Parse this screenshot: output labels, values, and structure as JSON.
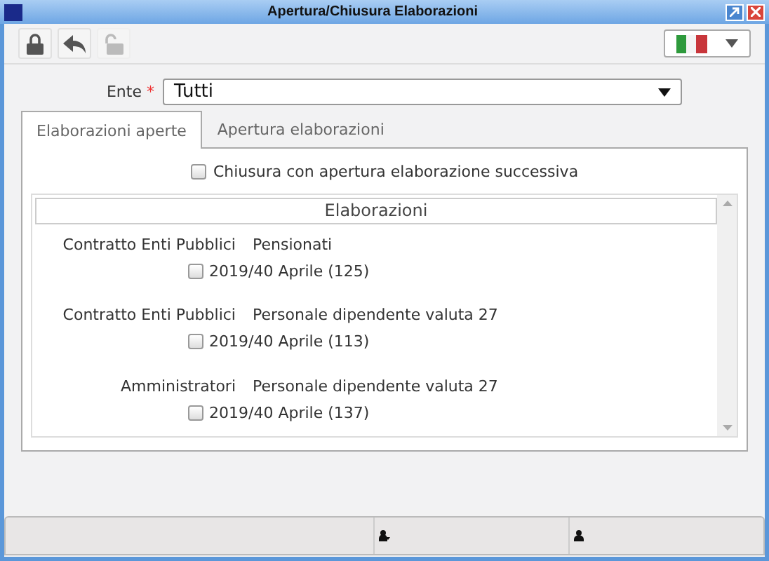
{
  "window": {
    "title": "Apertura/Chiusura Elaborazioni"
  },
  "toolbar": {
    "buttons": [
      {
        "kind": "lock",
        "disabled": false
      },
      {
        "kind": "back",
        "disabled": false
      },
      {
        "kind": "unlock",
        "disabled": true
      }
    ]
  },
  "ente": {
    "label": "Ente",
    "required_mark": "*",
    "value": "Tutti"
  },
  "tabs": [
    {
      "label": "Elaborazioni aperte",
      "selected": true
    },
    {
      "label": "Apertura elaborazioni",
      "selected": false
    }
  ],
  "option": {
    "label": "Chiusura con apertura elaborazione successiva",
    "checked": false
  },
  "list": {
    "header": "Elaborazioni",
    "groups": [
      {
        "category": "Contratto Enti Pubblici",
        "type": "Pensionati",
        "items": [
          {
            "label": "2019/40 Aprile (125)",
            "checked": false
          }
        ]
      },
      {
        "category": "Contratto Enti Pubblici",
        "type": "Personale dipendente valuta 27",
        "items": [
          {
            "label": "2019/40 Aprile (113)",
            "checked": false
          }
        ]
      },
      {
        "category": "Amministratori",
        "type": "Personale dipendente valuta 27",
        "items": [
          {
            "label": "2019/40 Aprile (137)",
            "checked": false
          }
        ]
      }
    ]
  }
}
